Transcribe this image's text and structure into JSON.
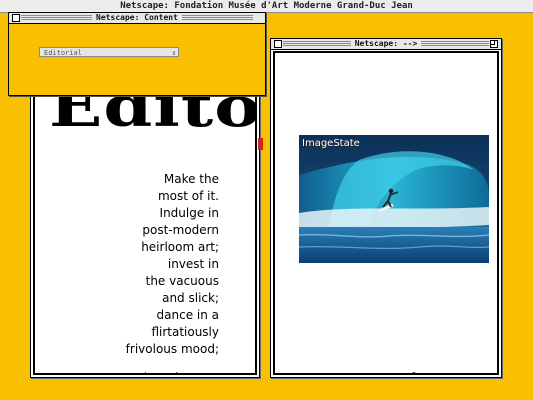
{
  "app": {
    "title": "Netscape: Fondation Musée d'Art Moderne Grand-Duc Jean"
  },
  "content_window": {
    "title": "Netscape: Content",
    "select_value": "Editorial"
  },
  "left_window": {
    "title": "",
    "heading": "Edito",
    "poem_lines": [
      "Make the",
      "most of it.",
      "Indulge in",
      "post-modern",
      "heirloom art;",
      "invest in",
      "the vacuous",
      "and slick;",
      "dance in a",
      "flirtatiously",
      "frivolous mood;"
    ]
  },
  "right_window": {
    "title": "Netscape: -->",
    "image_watermark": "ImageState"
  },
  "colors": {
    "desktop": "#f8c000",
    "ocean": "#1a86b8"
  },
  "icons": {
    "left_arrow": "double-headed-arrow-icon",
    "right_arrow": "right-arrow-icon",
    "cursor": "hand-pointer-icon"
  }
}
